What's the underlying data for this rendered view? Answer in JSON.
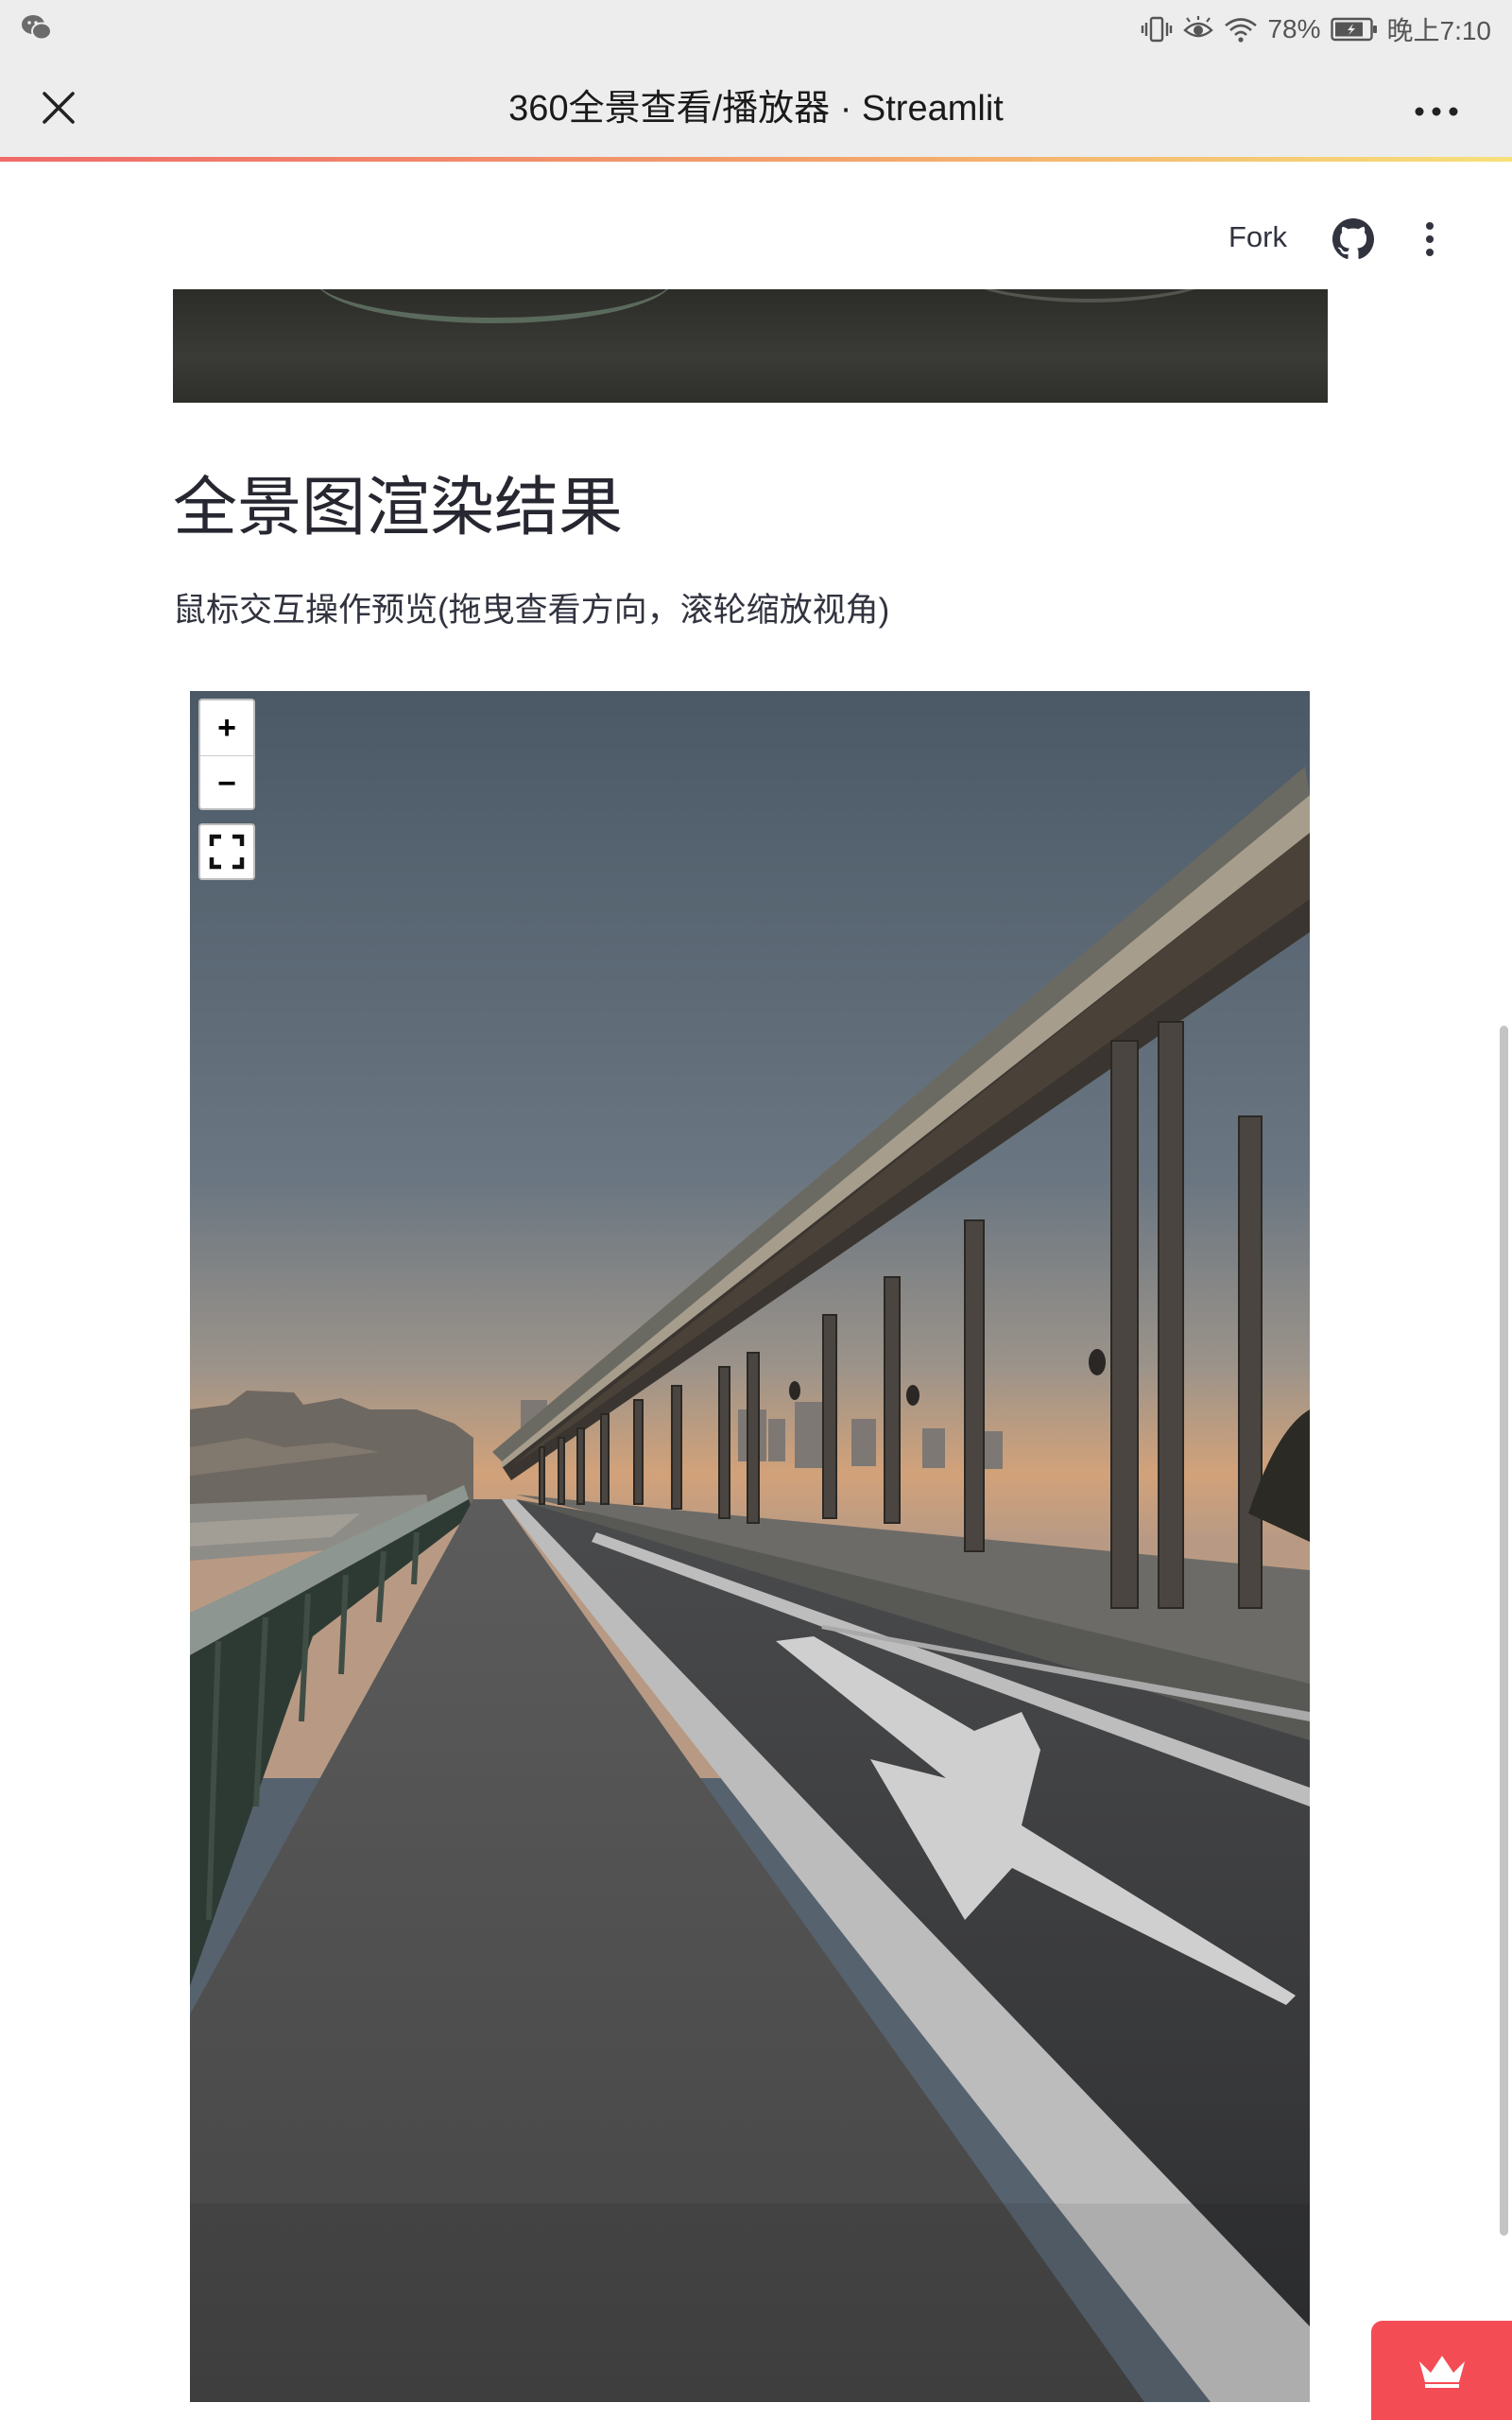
{
  "status_bar": {
    "left_icon": "wechat-icon",
    "battery_percent": "78%",
    "time": "晚上7:10",
    "icons": [
      "vibrate-icon",
      "eye-care-icon",
      "wifi-icon",
      "battery-icon"
    ]
  },
  "browser": {
    "title": "360全景查看/播放器 · Streamlit",
    "close_icon": "close-icon",
    "more_icon": "more-icon"
  },
  "streamlit_header": {
    "fork_label": "Fork",
    "github_icon": "github-icon",
    "menu_icon": "kebab-menu-icon"
  },
  "content": {
    "heading": "全景图渲染结果",
    "caption": "鼠标交互操作预览(拖曳查看方向，滚轮缩放视角)"
  },
  "viewer": {
    "zoom_in_label": "+",
    "zoom_out_label": "−",
    "fullscreen_icon": "fullscreen-icon"
  },
  "colors": {
    "progress_start": "#f06a6a",
    "progress_end": "#f7e07a",
    "streamlit_red": "#f44c55",
    "status_bg": "#ededed"
  }
}
